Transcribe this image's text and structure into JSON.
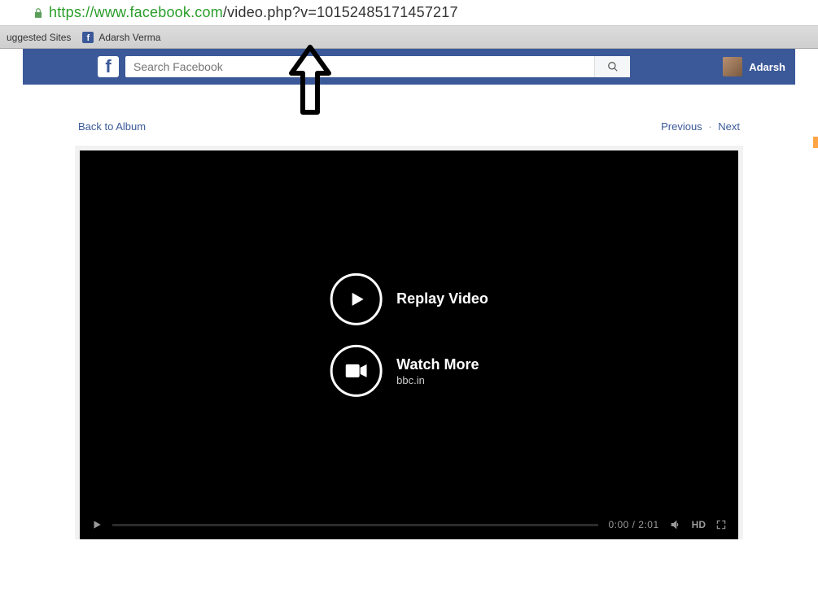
{
  "url": {
    "proto": "https",
    "host": "://www.facebook.com",
    "path": "/video.php?v=10152485171457217"
  },
  "bookmarks": {
    "suggested": "uggested Sites",
    "item1": "Adarsh Verma"
  },
  "search": {
    "placeholder": "Search Facebook"
  },
  "profile": {
    "name": "Adarsh"
  },
  "nav": {
    "back": "Back to Album",
    "prev": "Previous",
    "sep": "·",
    "next": "Next"
  },
  "player": {
    "replay_label": "Replay Video",
    "watch_more": "Watch More",
    "watch_more_source": "bbc.in",
    "time": "0:00 / 2:01",
    "hd": "HD"
  }
}
